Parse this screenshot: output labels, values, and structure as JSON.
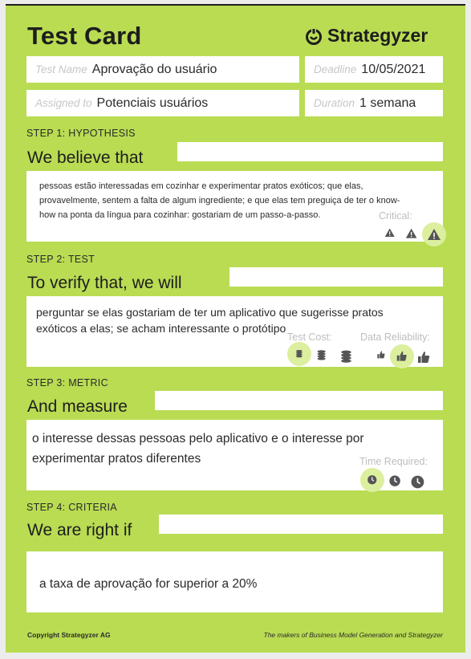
{
  "header": {
    "title": "Test Card",
    "brand": "Strategyzer"
  },
  "fields": {
    "test_name_label": "Test Name",
    "test_name": "Aprovação do usuário",
    "deadline_label": "Deadline",
    "deadline": "10/05/2021",
    "assigned_label": "Assigned to",
    "assigned": "Potenciais usuários",
    "duration_label": "Duration",
    "duration": "1 semana"
  },
  "step1": {
    "label": "STEP 1: HYPOTHESIS",
    "heading": "We believe that",
    "text": "pessoas estão interessadas em cozinhar e experimentar pratos exóticos; que elas, provavelmente, sentem a falta de algum ingrediente; e que elas tem preguiça de ter o know-how na ponta da língua para cozinhar: gostariam de um passo-a-passo.",
    "critical_label": "Critical:",
    "critical_level": 3,
    "critical_icon": "warning-icon"
  },
  "step2": {
    "label": "STEP 2: TEST",
    "heading": "To verify that, we will",
    "text": "perguntar se elas gostariam de ter um aplicativo que sugerisse pratos exóticos a elas; se acham interessante o protótipo",
    "cost_label": "Test Cost:",
    "cost_level": 1,
    "cost_icon": "coins-icon",
    "reliability_label": "Data Reliability:",
    "reliability_level": 2,
    "reliability_icon": "thumbs-up-icon"
  },
  "step3": {
    "label": "STEP 3: METRIC",
    "heading": "And measure",
    "text": "o interesse dessas pessoas pelo aplicativo e o interesse por experimentar pratos diferentes",
    "time_label": "Time Required:",
    "time_level": 1,
    "time_icon": "clock-icon"
  },
  "step4": {
    "label": "STEP 4: CRITERIA",
    "heading": "We are right if",
    "text": "a taxa de aprovação for superior a 20%"
  },
  "footer": {
    "copyright": "Copyright Strategyzer AG",
    "tagline": "The makers of Business Model Generation and Strategyzer"
  },
  "colors": {
    "card": "#b9dc53",
    "highlight": "#dcef9e",
    "icon": "#555555"
  }
}
